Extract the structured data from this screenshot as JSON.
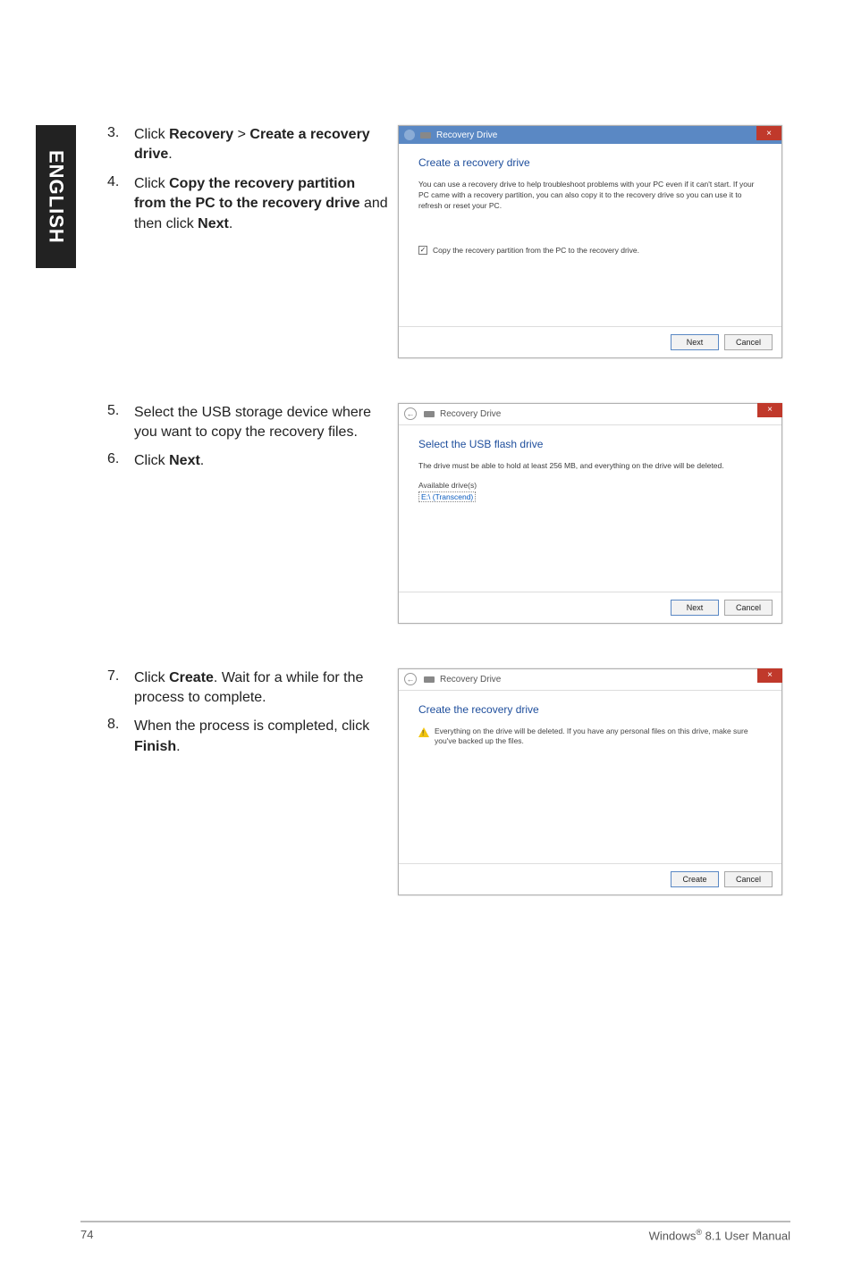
{
  "sideTab": "ENGLISH",
  "steps": {
    "s3": {
      "num": "3.",
      "pre": "Click ",
      "b1": "Recovery",
      "sep": " > ",
      "b2": "Create a recovery drive",
      "post": "."
    },
    "s4": {
      "num": "4.",
      "pre": "Click ",
      "b1": "Copy the recovery partition from the PC to the recovery drive",
      "mid": " and then click ",
      "b2": "Next",
      "post": "."
    },
    "s5": {
      "num": "5.",
      "text": "Select the USB storage device where you want to copy the recovery files."
    },
    "s6": {
      "num": "6.",
      "pre": "Click ",
      "b1": "Next",
      "post": "."
    },
    "s7": {
      "num": "7.",
      "pre": "Click ",
      "b1": "Create",
      "post": ". Wait for a while for the process to complete."
    },
    "s8": {
      "num": "8.",
      "pre": "When the process is completed, click ",
      "b1": "Finish",
      "post": "."
    }
  },
  "dialog1": {
    "title": "Recovery Drive",
    "heading": "Create a recovery drive",
    "body": "You can use a recovery drive to help troubleshoot problems with your PC even if it can't start. If your PC came with a recovery partition, you can also copy it to the recovery drive so you can use it to refresh or reset your PC.",
    "checkboxLabel": "Copy the recovery partition from the PC to the recovery drive.",
    "checkboxChecked": "✓",
    "nextBtn": "Next",
    "cancelBtn": "Cancel",
    "closeGlyph": "×"
  },
  "dialog2": {
    "title": "Recovery Drive",
    "heading": "Select the USB flash drive",
    "body": "The drive must be able to hold at least 256 MB, and everything on the drive will be deleted.",
    "availableLabel": "Available drive(s)",
    "driveItem": "E:\\ (Transcend)",
    "nextBtn": "Next",
    "cancelBtn": "Cancel",
    "closeGlyph": "×",
    "backGlyph": "←"
  },
  "dialog3": {
    "title": "Recovery Drive",
    "heading": "Create the recovery drive",
    "body": "Everything on the drive will be deleted. If you have any personal files on this drive, make sure you've backed up the files.",
    "createBtn": "Create",
    "cancelBtn": "Cancel",
    "closeGlyph": "×",
    "backGlyph": "←"
  },
  "footer": {
    "pageNum": "74",
    "right_pre": "Windows",
    "right_reg": "®",
    "right_post": " 8.1 User Manual"
  }
}
